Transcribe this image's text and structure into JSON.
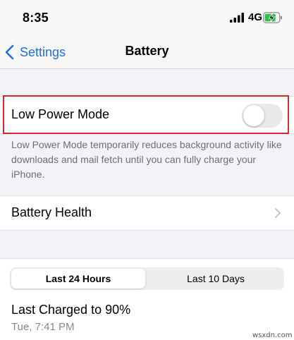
{
  "status_bar": {
    "time": "8:35",
    "network": "4G",
    "signal_icon": "cellular-signal-icon",
    "battery_icon": "battery-charging-icon",
    "battery_color": "#2fbf4a"
  },
  "nav": {
    "back_label": "Settings",
    "back_icon": "chevron-left-icon",
    "title": "Battery",
    "accent_color": "#1f6fe5"
  },
  "low_power": {
    "label": "Low Power Mode",
    "enabled": false,
    "highlight_color": "#d9272e",
    "description": "Low Power Mode temporarily reduces background activity like downloads and mail fetch until you can fully charge your iPhone."
  },
  "battery_health": {
    "label": "Battery Health",
    "chevron_icon": "chevron-right-icon"
  },
  "usage": {
    "tabs": [
      {
        "label": "Last 24 Hours",
        "selected": true
      },
      {
        "label": "Last 10 Days",
        "selected": false
      }
    ],
    "last_charged_title": "Last Charged to 90%",
    "last_charged_time": "Tue, 7:41 PM"
  },
  "watermark": "wsxdn.com"
}
